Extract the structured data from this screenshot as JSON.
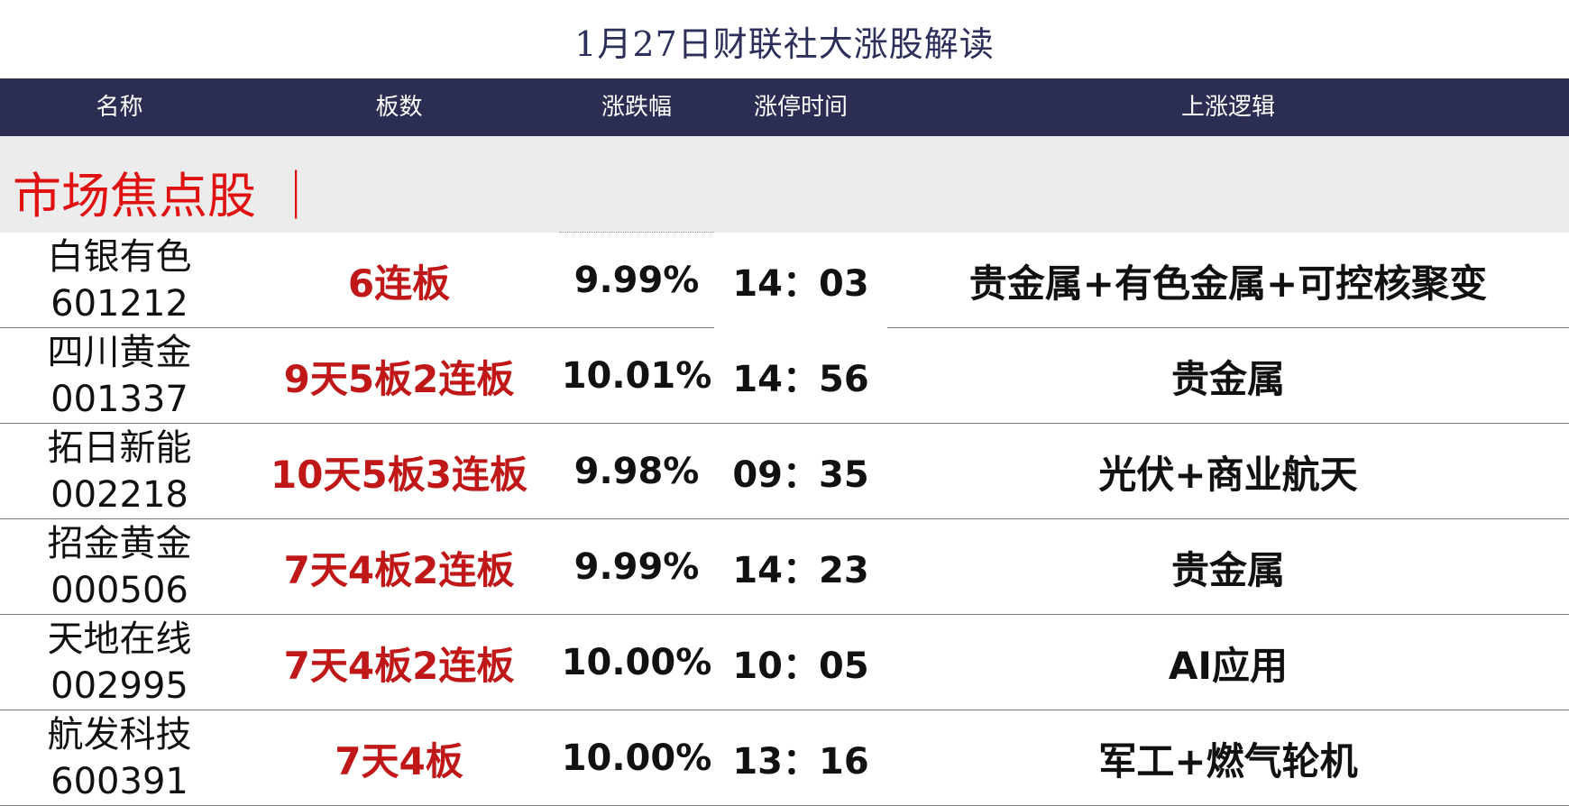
{
  "title": "1月27日财联社大涨股解读",
  "headers": {
    "name": "名称",
    "boards": "板数",
    "change": "涨跌幅",
    "limit_time": "涨停时间",
    "logic": "上涨逻辑"
  },
  "section_label": "市场焦点股 ｜",
  "colors": {
    "header_bg": "#2b2d52",
    "section_bg": "#ececec",
    "section_text": "#e01111",
    "board_text": "#c01818",
    "title_text": "#2c2f5a"
  },
  "rows": [
    {
      "name": "白银有色",
      "code": "601212",
      "boards": "6连板",
      "change": "9.99%",
      "time": "14：03",
      "logic": "贵金属+有色金属+可控核聚变"
    },
    {
      "name": "四川黄金",
      "code": "001337",
      "boards": "9天5板2连板",
      "change": "10.01%",
      "time": "14：56",
      "logic": "贵金属"
    },
    {
      "name": "拓日新能",
      "code": "002218",
      "boards": "10天5板3连板",
      "change": "9.98%",
      "time": "09：35",
      "logic": "光伏+商业航天"
    },
    {
      "name": "招金黄金",
      "code": "000506",
      "boards": "7天4板2连板",
      "change": "9.99%",
      "time": "14：23",
      "logic": "贵金属"
    },
    {
      "name": "天地在线",
      "code": "002995",
      "boards": "7天4板2连板",
      "change": "10.00%",
      "time": "10：05",
      "logic": "AI应用"
    },
    {
      "name": "航发科技",
      "code": "600391",
      "boards": "7天4板",
      "change": "10.00%",
      "time": "13：16",
      "logic": "军工+燃气轮机"
    }
  ]
}
